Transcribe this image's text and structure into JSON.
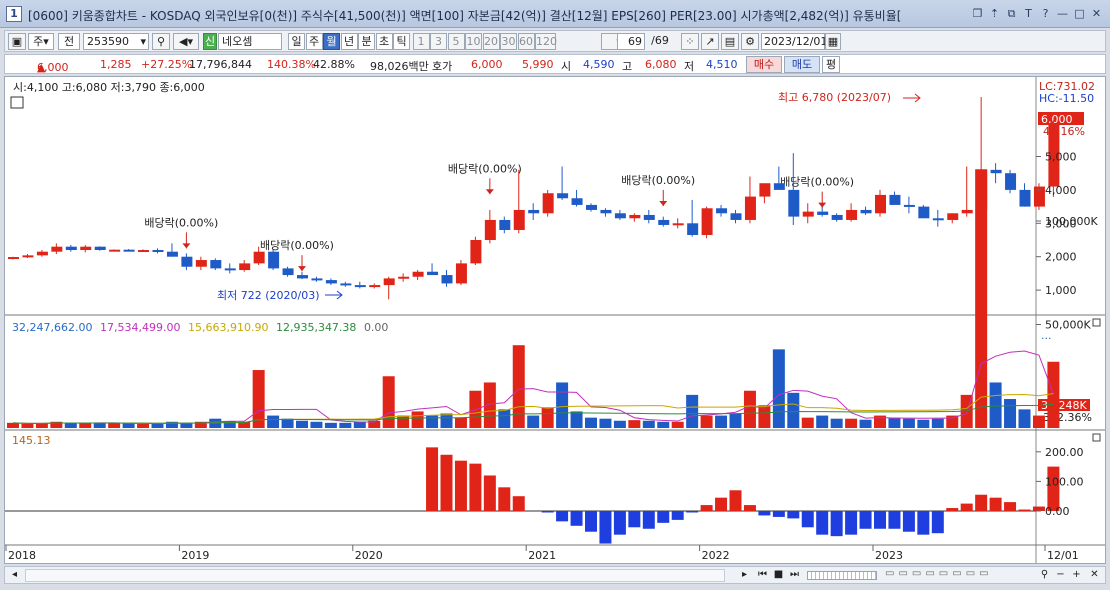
{
  "window": {
    "number": "1",
    "title": "[0600] 키움종합차트 - KOSDAQ 외국인보유[0(천)] 주식수[41,500(천)] 액면[100] 자본금[42(억)] 결산[12월] EPS[260] PER[23.00] 시가총액[2,482(억)] 유통비율[",
    "buttons": [
      "❐",
      "⇡",
      "⧉",
      "T",
      "?",
      "—",
      "□",
      "✕"
    ]
  },
  "toolbar": {
    "type_label": "주",
    "all_label": "전",
    "code": "253590",
    "stock_tag": "신",
    "stock_name": "네오셈",
    "periods": [
      "일",
      "주",
      "월",
      "년",
      "분",
      "초",
      "틱"
    ],
    "active_period": "월",
    "intervals": [
      "1",
      "3",
      "5",
      "10",
      "20",
      "30",
      "60",
      "120"
    ],
    "count": "69",
    "count_total": "/69",
    "date": "2023/12/01"
  },
  "quote": {
    "price": "6,000",
    "change": "1,285",
    "change_pct": "+27.25%",
    "volume": "17,796,844",
    "vol_ratio": "140.38%",
    "turnover": "42.88%",
    "amount": "98,026백만",
    "bid_label": "호가",
    "ask_price": "6,000",
    "bid_price": "5,990",
    "open_label": "시",
    "open": "4,590",
    "high_label": "고",
    "high": "6,080",
    "low_label": "저",
    "low": "4,510",
    "buy_label": "매수",
    "sell_label": "매도",
    "avg_label": "평"
  },
  "price_panel": {
    "info": "시:4,100 고:6,080 저:3,790 종:6,000",
    "lc_label": "LC:731.02",
    "hc_label": "HC:-11.50",
    "last_price": "6,000",
    "last_pct": "46.16%",
    "y_ticks": [
      "5,000",
      "4,000",
      "3,000",
      "2,000",
      "1,000"
    ],
    "dividend_label": "배당락(0.00%)",
    "high_note": "최고 6,780 (2023/07)",
    "low_note": "최저 722 (2020/03)"
  },
  "volume_panel": {
    "legend": [
      {
        "text": "32,247,662.00",
        "color": "#2a6bc4"
      },
      {
        "text": "17,534,499.00",
        "color": "#c02fbe"
      },
      {
        "text": "15,663,910.90",
        "color": "#c8a800"
      },
      {
        "text": "12,935,347.38",
        "color": "#2c8c3a"
      },
      {
        "text": "0.00",
        "color": "#666666"
      }
    ],
    "y_ticks": [
      "100,000K",
      "50,000K"
    ],
    "last_value": "32,248K",
    "last_pct": "352.36%"
  },
  "osc_panel": {
    "legend": "145.13",
    "y_ticks": [
      "200.00",
      "100.00",
      "0.00"
    ]
  },
  "x_axis": [
    "2018",
    "2019",
    "2020",
    "2021",
    "2022",
    "2023",
    "12/01"
  ],
  "chart_data": {
    "type": "candlestick",
    "period": "monthly",
    "note": "Monthly candles Jan 2018 – Dec 2023 (approximate)",
    "candles": [
      [
        1960,
        2000,
        1920,
        1990
      ],
      [
        1990,
        2080,
        1960,
        2040
      ],
      [
        2040,
        2200,
        2000,
        2150
      ],
      [
        2150,
        2400,
        2080,
        2300
      ],
      [
        2300,
        2350,
        2150,
        2200
      ],
      [
        2200,
        2350,
        2130,
        2300
      ],
      [
        2300,
        2310,
        2180,
        2200
      ],
      [
        2200,
        2220,
        2180,
        2210
      ],
      [
        2210,
        2230,
        2180,
        2200
      ],
      [
        2200,
        2220,
        2180,
        2200
      ],
      [
        2200,
        2250,
        2100,
        2150
      ],
      [
        2150,
        2400,
        2000,
        2000
      ],
      [
        2000,
        2100,
        1600,
        1700
      ],
      [
        1700,
        2000,
        1600,
        1900
      ],
      [
        1900,
        1950,
        1600,
        1650
      ],
      [
        1650,
        1800,
        1500,
        1600
      ],
      [
        1600,
        1900,
        1550,
        1800
      ],
      [
        1800,
        2300,
        1750,
        2150
      ],
      [
        2150,
        2200,
        1600,
        1650
      ],
      [
        1650,
        1700,
        1400,
        1450
      ],
      [
        1450,
        1550,
        1330,
        1350
      ],
      [
        1350,
        1400,
        1250,
        1300
      ],
      [
        1300,
        1350,
        1150,
        1200
      ],
      [
        1200,
        1250,
        1100,
        1150
      ],
      [
        1150,
        1250,
        1050,
        1100
      ],
      [
        1100,
        1200,
        1050,
        1150
      ],
      [
        1150,
        1400,
        722,
        1350
      ],
      [
        1350,
        1500,
        1250,
        1400
      ],
      [
        1400,
        1600,
        1300,
        1550
      ],
      [
        1550,
        1800,
        1500,
        1450
      ],
      [
        1450,
        1600,
        1100,
        1200
      ],
      [
        1200,
        1900,
        1150,
        1800
      ],
      [
        1800,
        2600,
        1750,
        2500
      ],
      [
        2500,
        3400,
        2400,
        3100
      ],
      [
        3100,
        3200,
        2700,
        2800
      ],
      [
        2800,
        4600,
        2700,
        3400
      ],
      [
        3400,
        3600,
        3100,
        3300
      ],
      [
        3300,
        4000,
        3200,
        3900
      ],
      [
        3900,
        4700,
        3700,
        3750
      ],
      [
        3750,
        4000,
        3500,
        3550
      ],
      [
        3550,
        3600,
        3350,
        3400
      ],
      [
        3400,
        3450,
        3200,
        3300
      ],
      [
        3300,
        3400,
        3100,
        3150
      ],
      [
        3150,
        3300,
        3050,
        3250
      ],
      [
        3250,
        3400,
        3000,
        3100
      ],
      [
        3100,
        3200,
        2900,
        2950
      ],
      [
        2950,
        3150,
        2850,
        3000
      ],
      [
        3000,
        3700,
        2600,
        2650
      ],
      [
        2650,
        3500,
        2550,
        3450
      ],
      [
        3450,
        3550,
        3200,
        3300
      ],
      [
        3300,
        3400,
        3000,
        3100
      ],
      [
        3100,
        4400,
        3000,
        3800
      ],
      [
        3800,
        4100,
        3600,
        4200
      ],
      [
        4200,
        4700,
        4000,
        4000
      ],
      [
        4000,
        5100,
        2950,
        3200
      ],
      [
        3200,
        3600,
        3000,
        3350
      ],
      [
        3350,
        3500,
        3200,
        3250
      ],
      [
        3250,
        3300,
        3050,
        3100
      ],
      [
        3100,
        3600,
        3050,
        3400
      ],
      [
        3400,
        3500,
        3250,
        3300
      ],
      [
        3300,
        4000,
        3200,
        3850
      ],
      [
        3850,
        3950,
        3600,
        3550
      ],
      [
        3550,
        3800,
        3300,
        3500
      ],
      [
        3500,
        3550,
        3200,
        3150
      ],
      [
        3150,
        3400,
        2900,
        3100
      ],
      [
        3100,
        3300,
        3000,
        3300
      ],
      [
        3300,
        4700,
        3200,
        3400
      ],
      [
        3400,
        6780,
        3300,
        4600
      ],
      [
        4600,
        4800,
        4200,
        4500
      ],
      [
        4500,
        4600,
        3900,
        4000
      ],
      [
        4000,
        4200,
        3500,
        3500
      ],
      [
        3500,
        4200,
        3400,
        4100
      ],
      [
        4100,
        6080,
        3790,
        6000
      ]
    ],
    "volume_k": [
      2500,
      2000,
      2200,
      3000,
      2500,
      2200,
      2500,
      2200,
      2200,
      2000,
      2000,
      3000,
      2500,
      3000,
      4500,
      3200,
      3000,
      28000,
      6000,
      4500,
      3500,
      3000,
      2500,
      2500,
      3000,
      3500,
      25000,
      6000,
      8000,
      6000,
      7000,
      5000,
      18000,
      22000,
      9000,
      40000,
      6000,
      10000,
      22000,
      8000,
      5000,
      4500,
      3500,
      3800,
      3500,
      3000,
      3000,
      16000,
      6000,
      6000,
      7000,
      18000,
      11000,
      38000,
      17000,
      5000,
      6000,
      4500,
      4500,
      4000,
      6000,
      5000,
      4500,
      4000,
      4500,
      6000,
      16000,
      125000,
      22000,
      14000,
      9000,
      6000,
      32000
    ],
    "oscillator": [
      215,
      190,
      170,
      160,
      120,
      80,
      50,
      0,
      -5,
      -35,
      -50,
      -70,
      -110,
      -80,
      -55,
      -60,
      -40,
      -30,
      -5,
      20,
      45,
      70,
      20,
      -15,
      -20,
      -25,
      -55,
      -80,
      -85,
      -80,
      -60,
      -60,
      -60,
      -70,
      -80,
      -75,
      10,
      25,
      55,
      45,
      30,
      5,
      15,
      150
    ]
  }
}
